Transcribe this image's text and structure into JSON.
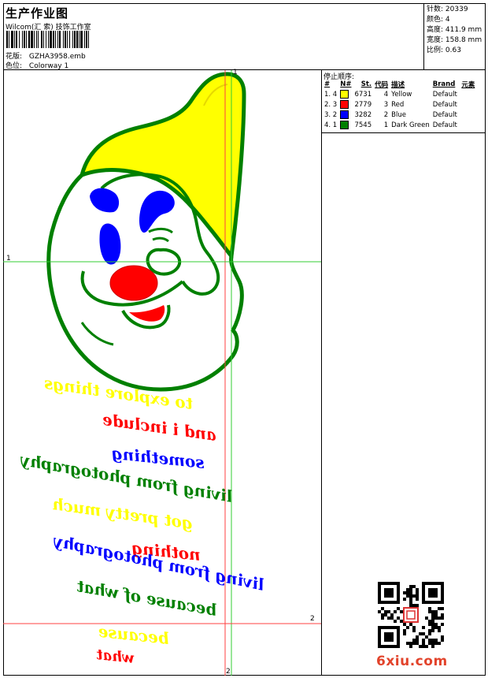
{
  "header": {
    "title": "生产作业图",
    "company": "Wilcom(汇 索) 技饰工作室",
    "design_label": "花版:",
    "design_value": "GZHA3958.emb",
    "colorway_label": "色位:",
    "colorway_value": "Colorway 1"
  },
  "stats": [
    {
      "label": "针数:",
      "value": "20339"
    },
    {
      "label": "颜色:",
      "value": "4"
    },
    {
      "label": "高度:",
      "value": "411.9 mm"
    },
    {
      "label": "宽度:",
      "value": "158.8 mm"
    },
    {
      "label": "比例:",
      "value": "0.63"
    }
  ],
  "stop_sequence": {
    "caption": "停止顺序:",
    "columns": [
      "#",
      "N#",
      "St.",
      "代码",
      "描述",
      "Brand",
      "元素"
    ],
    "rows": [
      {
        "num": "1. 4",
        "st": "6731",
        "code": "4",
        "desc": "Yellow",
        "brand": "Default",
        "color": "#ffff00"
      },
      {
        "num": "2. 3",
        "st": "2779",
        "code": "3",
        "desc": "Red",
        "brand": "Default",
        "color": "#ff0000"
      },
      {
        "num": "3. 2",
        "st": "3282",
        "code": "2",
        "desc": "Blue",
        "brand": "Default",
        "color": "#0000ff"
      },
      {
        "num": "4. 1",
        "st": "7545",
        "code": "1",
        "desc": "Dark Green",
        "brand": "Default",
        "color": "#008000"
      }
    ]
  },
  "guides": {
    "v1": "1",
    "h1": "1",
    "v2": "2",
    "h2": "2"
  },
  "embroidery_text": [
    {
      "text": "to explore things",
      "color": "#ffff00"
    },
    {
      "text": "and i include",
      "color": "#ff0000"
    },
    {
      "text": "something",
      "color": "#0000ff"
    },
    {
      "text": "living from photography",
      "color": "#008000"
    },
    {
      "text": "got pretty much",
      "color": "#ffff00"
    },
    {
      "text": "nothing",
      "color": "#ff0000"
    },
    {
      "text": "living from photography",
      "color": "#0000ff"
    },
    {
      "text": "because of what",
      "color": "#008000"
    },
    {
      "text": "because",
      "color": "#ffff00"
    },
    {
      "text": "what",
      "color": "#ff0000"
    }
  ],
  "watermark": "6xiu.com",
  "colors": {
    "yellow": "#ffff00",
    "red": "#ff0000",
    "blue": "#0000ff",
    "green": "#008000",
    "guide_green": "#33cc33",
    "guide_red": "#ff4040"
  }
}
